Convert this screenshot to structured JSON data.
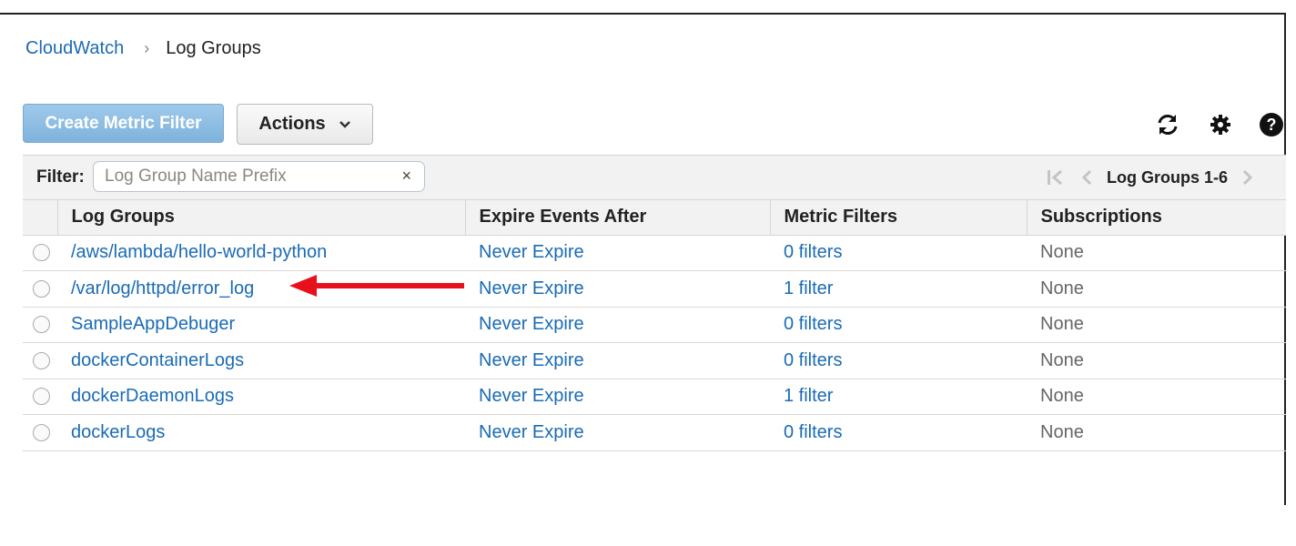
{
  "breadcrumb": {
    "root": "CloudWatch",
    "separator": "›",
    "current": "Log Groups"
  },
  "toolbar": {
    "create_label": "Create Metric Filter",
    "actions_label": "Actions",
    "icons": [
      "refresh-icon",
      "gear-icon",
      "help-icon"
    ]
  },
  "filter": {
    "label": "Filter:",
    "placeholder": "Log Group Name Prefix",
    "value": "",
    "clear": "×"
  },
  "pager": {
    "label": "Log Groups 1-6"
  },
  "table": {
    "columns": [
      "Log Groups",
      "Expire Events After",
      "Metric Filters",
      "Subscriptions"
    ],
    "rows": [
      {
        "name": "/aws/lambda/hello-world-python",
        "expire": "Never Expire",
        "filters": "0 filters",
        "subs": "None"
      },
      {
        "name": "/var/log/httpd/error_log",
        "expire": "Never Expire",
        "filters": "1 filter",
        "subs": "None"
      },
      {
        "name": "SampleAppDebuger",
        "expire": "Never Expire",
        "filters": "0 filters",
        "subs": "None"
      },
      {
        "name": "dockerContainerLogs",
        "expire": "Never Expire",
        "filters": "0 filters",
        "subs": "None"
      },
      {
        "name": "dockerDaemonLogs",
        "expire": "Never Expire",
        "filters": "1 filter",
        "subs": "None"
      },
      {
        "name": "dockerLogs",
        "expire": "Never Expire",
        "filters": "0 filters",
        "subs": "None"
      }
    ]
  },
  "colors": {
    "link": "#1a6bb5",
    "primary_button": "#8fbfe4",
    "annotation_arrow": "#e8101a"
  }
}
